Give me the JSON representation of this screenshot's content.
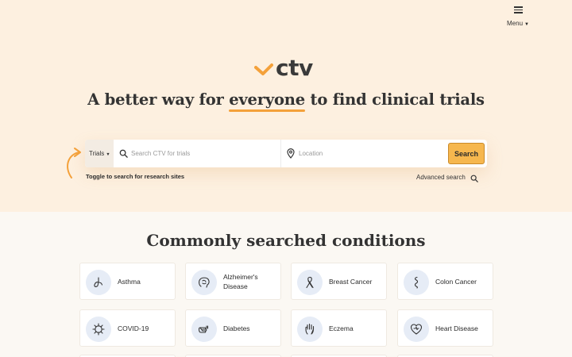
{
  "header": {
    "menu_label": "Menu"
  },
  "logo": {
    "text": "ctv"
  },
  "hero": {
    "headline_before": "A better way for ",
    "headline_highlight": "everyone",
    "headline_after": " to find clinical trials"
  },
  "search": {
    "mode_label": "Trials",
    "query_placeholder": "Search CTV for trials",
    "location_placeholder": "Location",
    "button_label": "Search",
    "toggle_hint": "Toggle to search for research sites",
    "advanced_label": "Advanced search"
  },
  "conditions": {
    "title": "Commonly searched conditions",
    "items": [
      {
        "label": "Asthma",
        "icon": "lungs-icon"
      },
      {
        "label": "Alzheimer's Disease",
        "icon": "brain-icon"
      },
      {
        "label": "Breast Cancer",
        "icon": "ribbon-icon"
      },
      {
        "label": "Colon Cancer",
        "icon": "colon-icon"
      },
      {
        "label": "COVID-19",
        "icon": "virus-icon"
      },
      {
        "label": "Diabetes",
        "icon": "glucose-meter-icon"
      },
      {
        "label": "Eczema",
        "icon": "hand-icon"
      },
      {
        "label": "Heart Disease",
        "icon": "heart-icon"
      }
    ]
  },
  "colors": {
    "accent": "#f4a13a",
    "search_button": "#f6b74e",
    "hero_bg": "#fdf0e0",
    "icon_badge": "#e6ecf6"
  }
}
